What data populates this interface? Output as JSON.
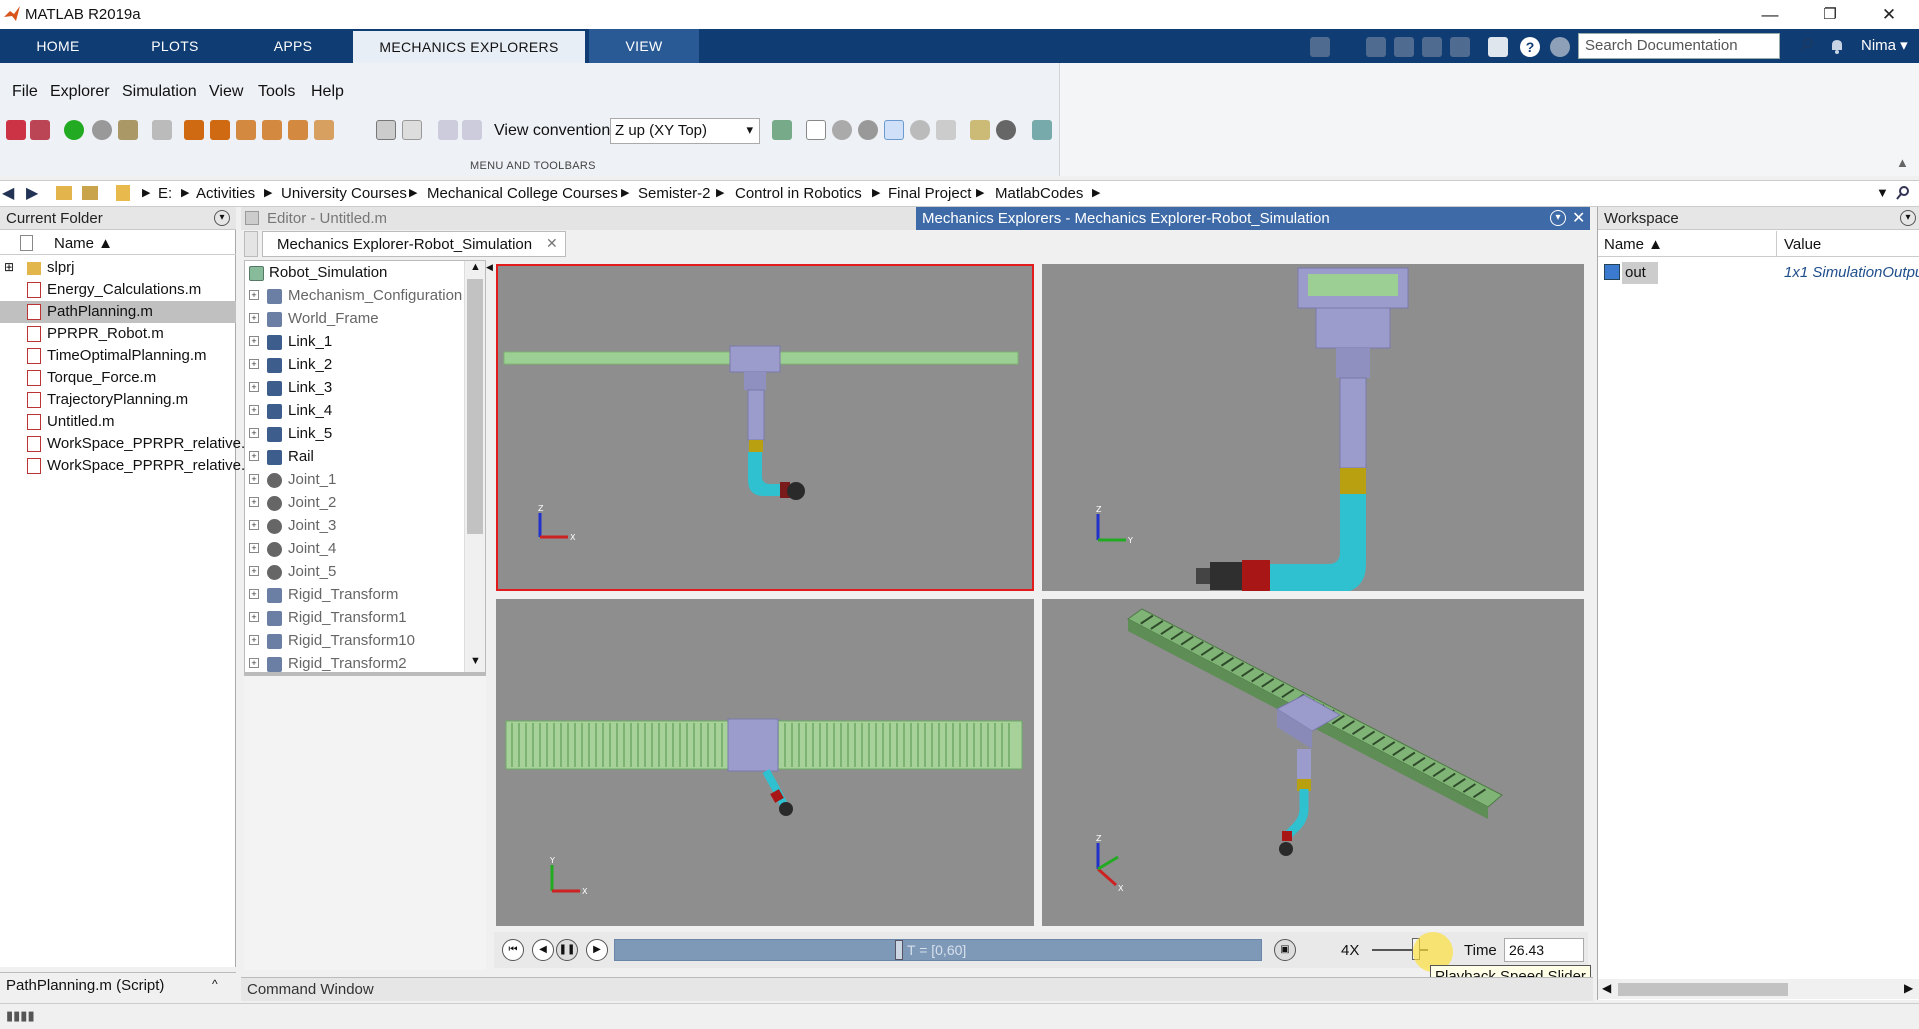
{
  "window": {
    "title": "MATLAB R2019a",
    "minimize": "—",
    "restore": "❐",
    "close": "✕"
  },
  "ribbon_tabs": [
    {
      "label": "HOME"
    },
    {
      "label": "PLOTS"
    },
    {
      "label": "APPS"
    },
    {
      "label": "MECHANICS EXPLORERS"
    },
    {
      "label": "VIEW"
    }
  ],
  "search": {
    "placeholder": "Search Documentation"
  },
  "user": {
    "name": "Nima ▾"
  },
  "menu": [
    "File",
    "Explorer",
    "Simulation",
    "View",
    "Tools",
    "Help"
  ],
  "toolbar": {
    "view_convention_label": "View convention:",
    "view_convention_value": "Z up (XY Top)",
    "section_label": "MENU AND TOOLBARS"
  },
  "breadcrumb": [
    "E:",
    "Activities",
    "University Courses",
    "Mechanical College Courses",
    "Semister-2",
    "Control in Robotics",
    "Final Project",
    "MatlabCodes"
  ],
  "current_folder": {
    "title": "Current Folder",
    "column": "Name ▲",
    "items": [
      {
        "name": "slprj",
        "type": "folder"
      },
      {
        "name": "Energy_Calculations.m",
        "type": "file"
      },
      {
        "name": "PathPlanning.m",
        "type": "file",
        "selected": true
      },
      {
        "name": "PPRPR_Robot.m",
        "type": "file"
      },
      {
        "name": "TimeOptimalPlanning.m",
        "type": "file"
      },
      {
        "name": "Torque_Force.m",
        "type": "file"
      },
      {
        "name": "TrajectoryPlanning.m",
        "type": "file"
      },
      {
        "name": "Untitled.m",
        "type": "file"
      },
      {
        "name": "WorkSpace_PPRPR_relative...",
        "type": "file"
      },
      {
        "name": "WorkSpace_PPRPR_relative...",
        "type": "file"
      }
    ],
    "footer": "PathPlanning.m  (Script)"
  },
  "editor": {
    "title": "Editor - Untitled.m"
  },
  "mech_explorer": {
    "title": "Mechanics Explorers - Mechanics Explorer-Robot_Simulation",
    "tab": "Mechanics Explorer-Robot_Simulation",
    "tree_root": "Robot_Simulation",
    "tree_items": [
      {
        "label": "Mechanism_Configuration",
        "kind": "config",
        "active": false
      },
      {
        "label": "World_Frame",
        "kind": "frame",
        "active": false
      },
      {
        "label": "Link_1",
        "kind": "body",
        "active": true
      },
      {
        "label": "Link_2",
        "kind": "body",
        "active": true
      },
      {
        "label": "Link_3",
        "kind": "body",
        "active": true
      },
      {
        "label": "Link_4",
        "kind": "body",
        "active": true
      },
      {
        "label": "Link_5",
        "kind": "body",
        "active": true
      },
      {
        "label": "Rail",
        "kind": "body",
        "active": true
      },
      {
        "label": "Joint_1",
        "kind": "joint",
        "active": false
      },
      {
        "label": "Joint_2",
        "kind": "joint",
        "active": false
      },
      {
        "label": "Joint_3",
        "kind": "joint",
        "active": false
      },
      {
        "label": "Joint_4",
        "kind": "joint",
        "active": false
      },
      {
        "label": "Joint_5",
        "kind": "joint",
        "active": false
      },
      {
        "label": "Rigid_Transform",
        "kind": "transform",
        "active": false
      },
      {
        "label": "Rigid_Transform1",
        "kind": "transform",
        "active": false
      },
      {
        "label": "Rigid_Transform10",
        "kind": "transform",
        "active": false
      },
      {
        "label": "Rigid_Transform2",
        "kind": "transform",
        "active": false
      }
    ],
    "timeline_label": "T = [0,60]",
    "timeline_progress": 0.44,
    "speed": "4X",
    "time_label": "Time",
    "time_value": "26.43",
    "tooltip": "Playback Speed Slider"
  },
  "command_window": {
    "title": "Command Window"
  },
  "workspace": {
    "title": "Workspace",
    "columns": [
      "Name ▲",
      "Value"
    ],
    "rows": [
      {
        "name": "out",
        "value": "1x1 SimulationOutpu"
      }
    ]
  },
  "colors": {
    "tab_bar": "#0f3c73",
    "mech_title": "#3e6aa7",
    "viewport": "#8e8e8e",
    "rail_green": "#9ccf93",
    "link_purple": "#9c9ccc",
    "cyan": "#2fc1d0",
    "selected_border": "#e21c1c"
  }
}
